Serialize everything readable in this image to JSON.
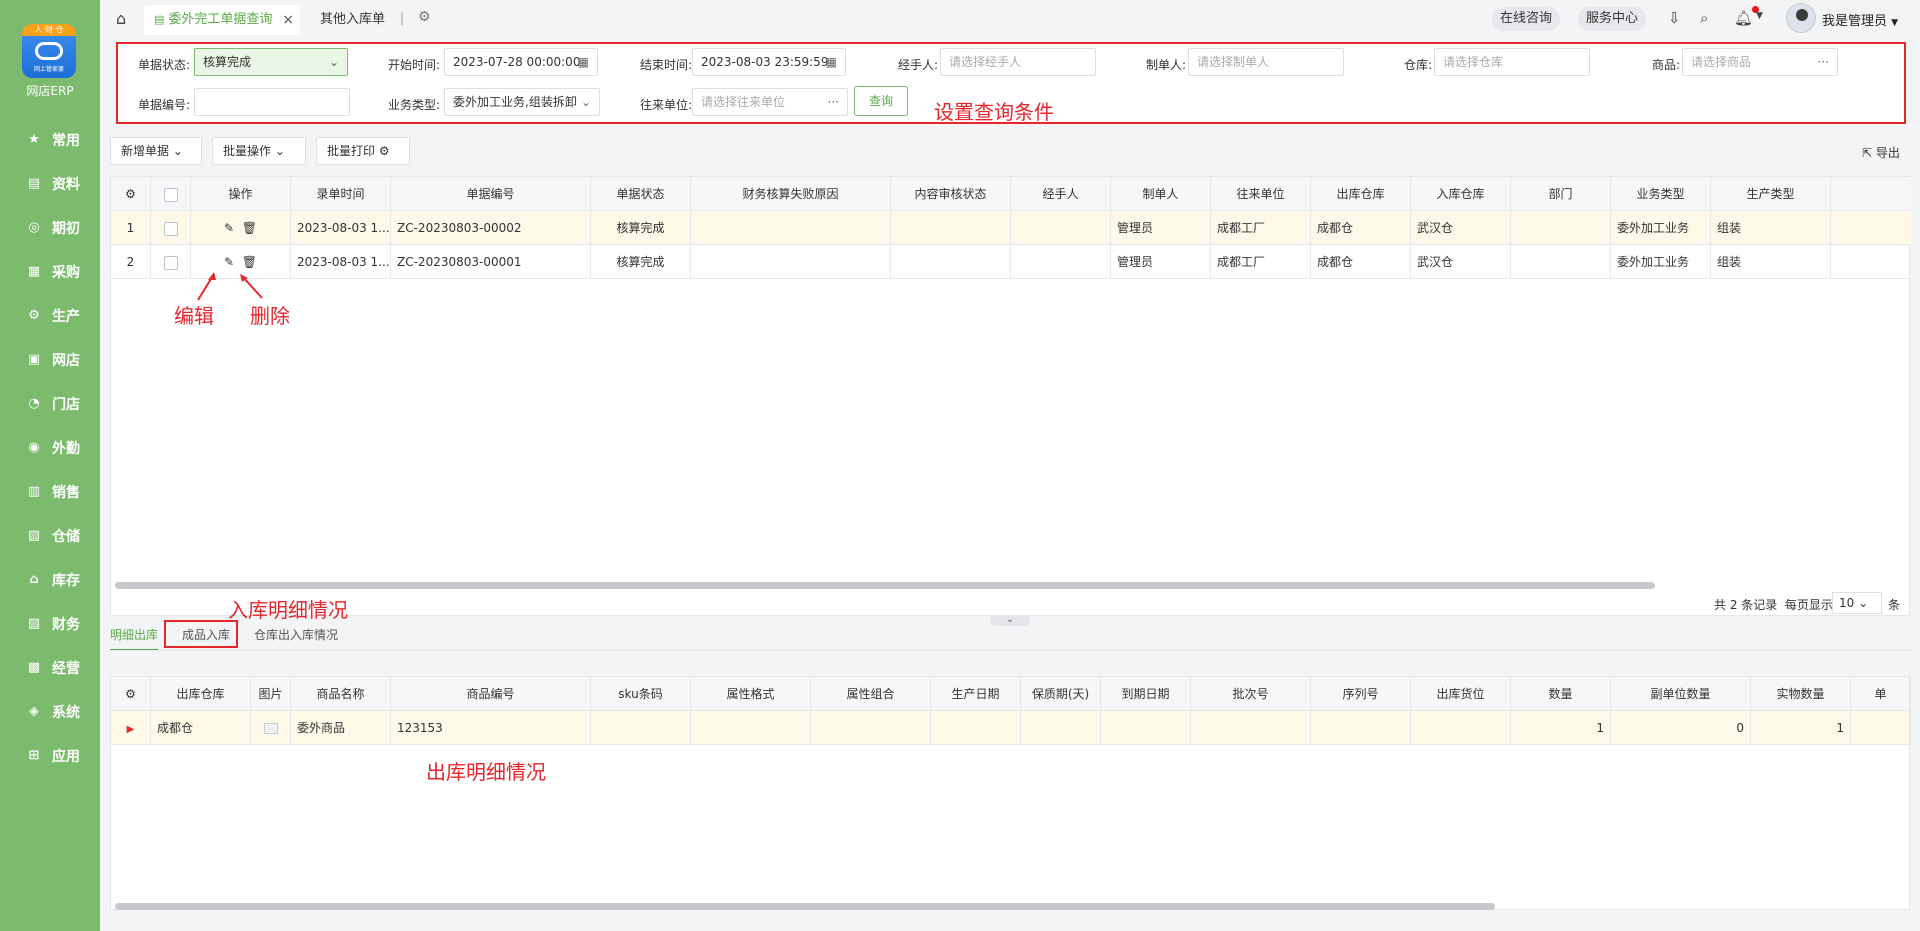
{
  "sidebar": {
    "logo_ribbon": "人·财·仓",
    "logo_sub": "网上管家婆",
    "logo_text": "网店ERP",
    "items": [
      {
        "label": "常用",
        "icon": "★"
      },
      {
        "label": "资料",
        "icon": "▤"
      },
      {
        "label": "期初",
        "icon": "◎"
      },
      {
        "label": "采购",
        "icon": "▦"
      },
      {
        "label": "生产",
        "icon": "⚙"
      },
      {
        "label": "网店",
        "icon": "▣"
      },
      {
        "label": "门店",
        "icon": "◔"
      },
      {
        "label": "外勤",
        "icon": "◉"
      },
      {
        "label": "销售",
        "icon": "▥"
      },
      {
        "label": "仓储",
        "icon": "▧"
      },
      {
        "label": "库存",
        "icon": "⌂"
      },
      {
        "label": "财务",
        "icon": "▨"
      },
      {
        "label": "经营",
        "icon": "▩"
      },
      {
        "label": "系统",
        "icon": "◈"
      },
      {
        "label": "应用",
        "icon": "⊞"
      }
    ]
  },
  "topbar": {
    "active_tab": "委外完工单据查询",
    "other_tab": "其他入库单",
    "consult": "在线咨询",
    "service": "服务中心",
    "user": "我是管理员"
  },
  "query": {
    "status_label": "单据状态:",
    "status_value": "核算完成",
    "start_label": "开始时间:",
    "start_value": "2023-07-28 00:00:00",
    "end_label": "结束时间:",
    "end_value": "2023-08-03 23:59:59",
    "handler_label": "经手人:",
    "handler_ph": "请选择经手人",
    "maker_label": "制单人:",
    "maker_ph": "请选择制单人",
    "warehouse_label": "仓库:",
    "warehouse_ph": "请选择仓库",
    "goods_label": "商品:",
    "goods_ph": "请选择商品",
    "docno_label": "单据编号:",
    "biztype_label": "业务类型:",
    "biztype_value": "委外加工业务,组装拆卸",
    "partner_label": "往来单位:",
    "partner_ph": "请选择往来单位",
    "query_btn": "查询"
  },
  "annotations": {
    "query": "设置查询条件",
    "edit": "编辑",
    "delete": "删除",
    "in_detail": "入库明细情况",
    "out_detail": "出库明细情况"
  },
  "toolbar": {
    "new": "新增单据",
    "batch": "批量操作",
    "print": "批量打印",
    "export": "导出"
  },
  "table": {
    "headers": [
      "操作",
      "录单时间",
      "单据编号",
      "单据状态",
      "财务核算失败原因",
      "内容审核状态",
      "经手人",
      "制单人",
      "往来单位",
      "出库仓库",
      "入库仓库",
      "部门",
      "业务类型",
      "生产类型"
    ],
    "rows": [
      {
        "no": "1",
        "time": "2023-08-03 1...",
        "docno": "ZC-20230803-00002",
        "status": "核算完成",
        "reason": "",
        "audit": "",
        "handler": "",
        "maker": "管理员",
        "partner": "成都工厂",
        "out_wh": "成都仓",
        "in_wh": "武汉仓",
        "dept": "",
        "biz": "委外加工业务",
        "prod": "组装"
      },
      {
        "no": "2",
        "time": "2023-08-03 1...",
        "docno": "ZC-20230803-00001",
        "status": "核算完成",
        "reason": "",
        "audit": "",
        "handler": "",
        "maker": "管理员",
        "partner": "成都工厂",
        "out_wh": "成都仓",
        "in_wh": "武汉仓",
        "dept": "",
        "biz": "委外加工业务",
        "prod": "组装"
      }
    ]
  },
  "pager": {
    "total": "共 2 条记录",
    "per_page": "每页显示",
    "size": "10",
    "tail": "条"
  },
  "detail_tabs": [
    "明细出库",
    "成品入库",
    "仓库出入库情况"
  ],
  "detail": {
    "headers": [
      "出库仓库",
      "图片",
      "商品名称",
      "商品编号",
      "sku条码",
      "属性格式",
      "属性组合",
      "生产日期",
      "保质期(天)",
      "到期日期",
      "批次号",
      "序列号",
      "出库货位",
      "数量",
      "副单位数量",
      "实物数量",
      "单"
    ],
    "rows": [
      {
        "wh": "成都仓",
        "name": "委外商品",
        "code": "123153",
        "qty": "1",
        "sub_qty": "0",
        "real_qty": "1"
      }
    ]
  }
}
